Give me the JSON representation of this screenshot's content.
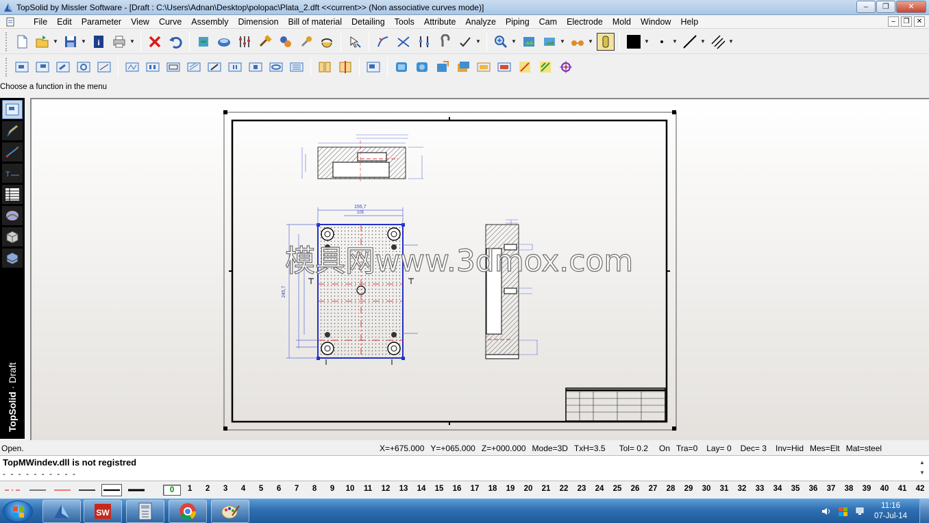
{
  "window": {
    "title": "TopSolid by Missler Software - [Draft : C:\\Users\\Adnan\\Desktop\\polopac\\Plata_2.dft  <<current>> (Non associative curves mode)]"
  },
  "menu": [
    "File",
    "Edit",
    "Parameter",
    "View",
    "Curve",
    "Assembly",
    "Dimension",
    "Bill of material",
    "Detailing",
    "Tools",
    "Attribute",
    "Analyze",
    "Piping",
    "Cam",
    "Electrode",
    "Mold",
    "Window",
    "Help"
  ],
  "prompt": "Choose a function in the menu",
  "side_label": {
    "brand": "TopSolid",
    "mode": "Draft"
  },
  "drawing": {
    "dim_width": "155,7",
    "dim_inner": "105",
    "dim_height": "245,7",
    "watermark": "模具网www.3dmox.com"
  },
  "status": {
    "left": "Open.",
    "x": "X=+675.000",
    "y": "Y=+065.000",
    "z": "Z=+000.000",
    "mode": "Mode=3D",
    "txh": "TxH=3.5",
    "tol": "Tol=  0.2",
    "on": "On",
    "tra": "Tra=0",
    "lay": "Lay=  0",
    "dec": "Dec= 3",
    "inv": "Inv=Hid",
    "mes": "Mes=Elt",
    "mat": "Mat=steel"
  },
  "console": {
    "message": "TopMWindev.dll is not registred",
    "dashes": "- - - - - - - - - -"
  },
  "layers": [
    "0",
    "1",
    "2",
    "3",
    "4",
    "5",
    "6",
    "7",
    "8",
    "9",
    "10",
    "11",
    "12",
    "13",
    "14",
    "15",
    "16",
    "17",
    "18",
    "19",
    "20",
    "21",
    "22",
    "23",
    "24",
    "25",
    "26",
    "27",
    "28",
    "29",
    "30",
    "31",
    "32",
    "33",
    "34",
    "35",
    "36",
    "37",
    "38",
    "39",
    "40",
    "41",
    "42"
  ],
  "clock": {
    "time": "11:16",
    "date": "07-Jul-14"
  }
}
